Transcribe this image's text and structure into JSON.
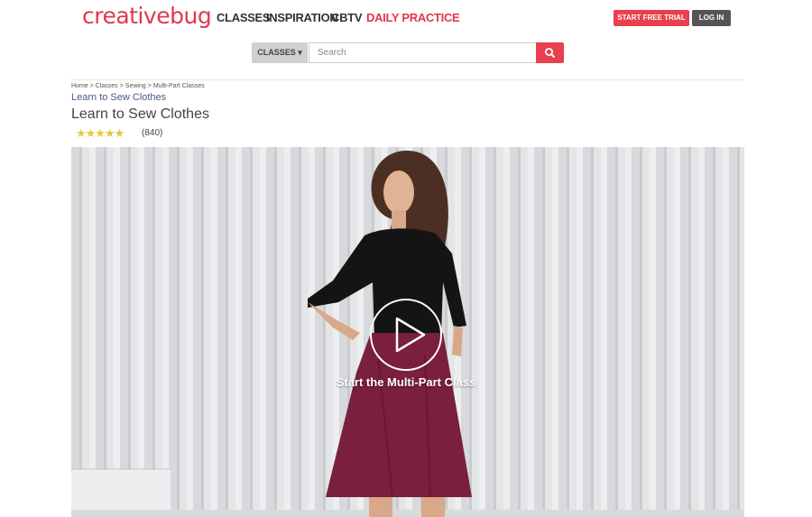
{
  "header": {
    "logo_text": "creativebug",
    "nav": [
      {
        "label": "CLASSES"
      },
      {
        "label": "INSPIRATION"
      },
      {
        "label": "CBTV"
      },
      {
        "label": "DAILY PRACTICE"
      }
    ],
    "trial_label": "START FREE TRIAL",
    "login_label": "LOG IN"
  },
  "search": {
    "dropdown_label": "CLASSES ▾",
    "placeholder": "Search",
    "value": ""
  },
  "breadcrumb": [
    "Home",
    "Classes",
    "Sewing",
    "Multi-Part Classes"
  ],
  "breadcrumb_sep": ">",
  "class": {
    "subtitle": "Learn to Sew Clothes",
    "title": "Learn to Sew Clothes",
    "stars": "★★★★★",
    "rating_value": 5,
    "rating_count": "(840)"
  },
  "video": {
    "play_caption": "Start the Multi-Part Class"
  },
  "colors": {
    "brand": "#e0384c",
    "login_button": "#555555",
    "star": "#e2c93a",
    "skirt": "#7a1f3d"
  },
  "icons": {
    "search": "search-icon",
    "play": "play-icon"
  }
}
